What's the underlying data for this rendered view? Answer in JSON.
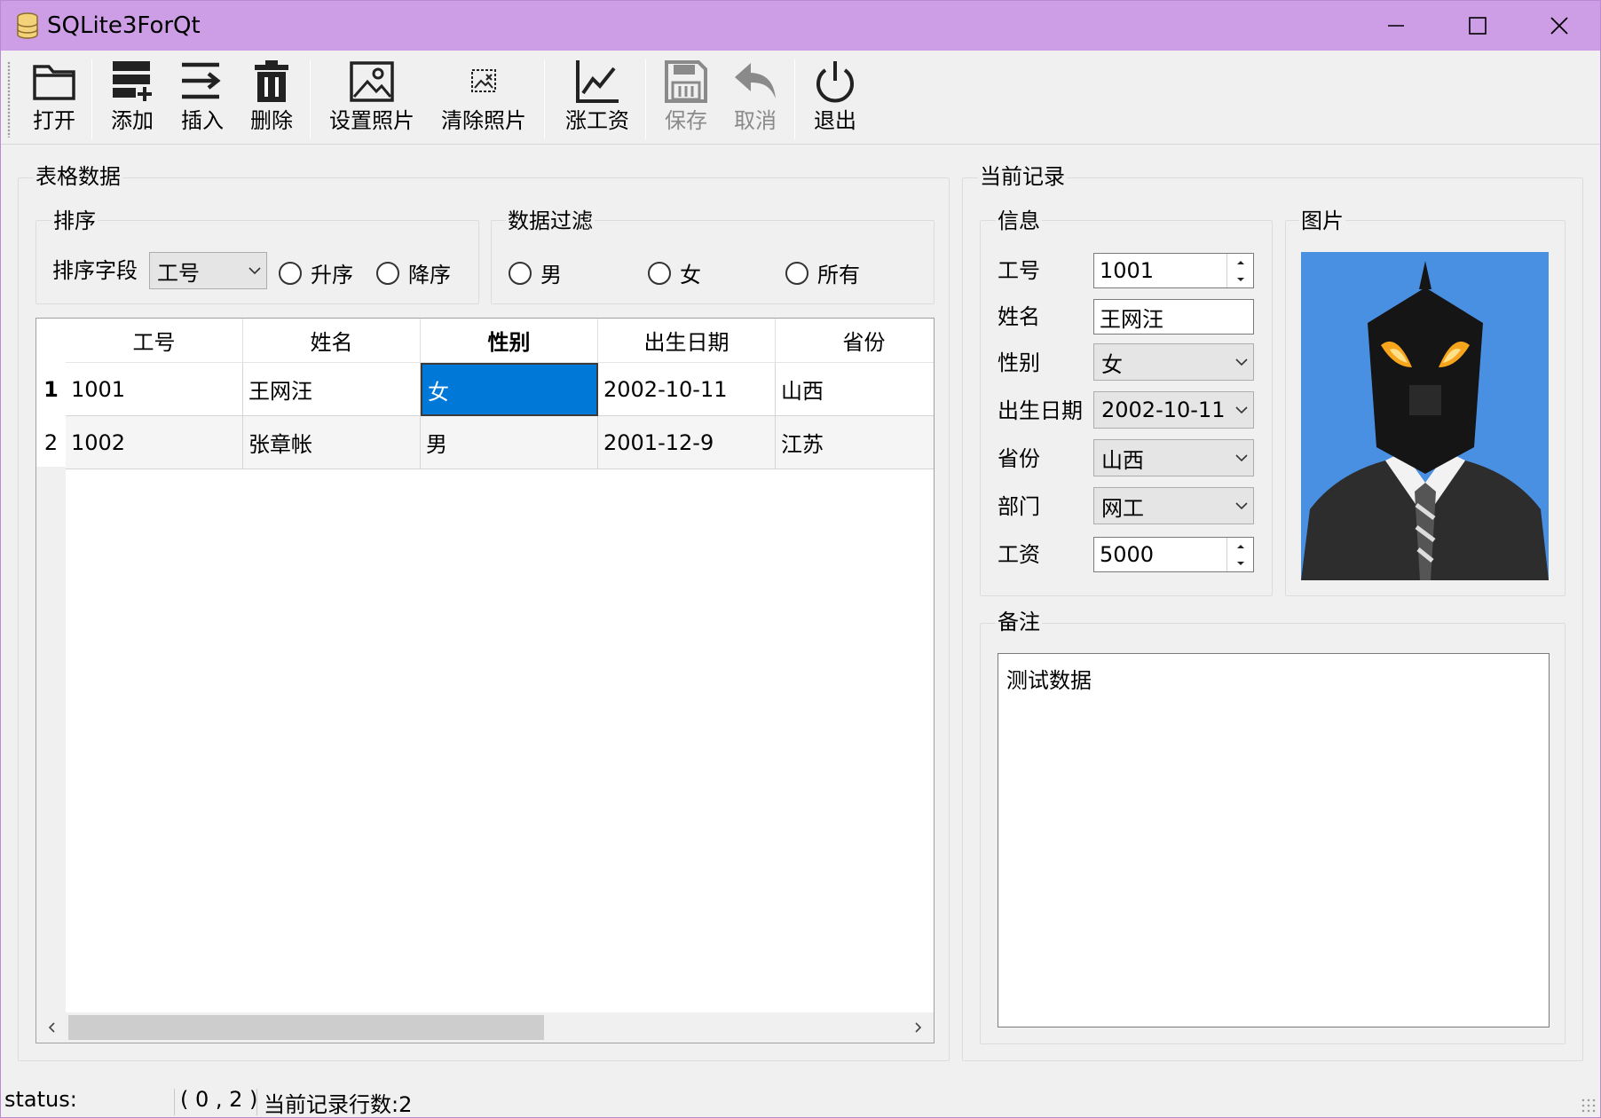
{
  "window": {
    "title": "SQLite3ForQt"
  },
  "toolbar": [
    {
      "label": "打开",
      "icon": "folder-icon",
      "enabled": true
    },
    {
      "label": "添加",
      "icon": "add-record-icon",
      "enabled": true
    },
    {
      "label": "插入",
      "icon": "insert-icon",
      "enabled": true
    },
    {
      "label": "删除",
      "icon": "trash-icon",
      "enabled": true
    },
    {
      "label": "设置照片",
      "icon": "image-icon",
      "enabled": true
    },
    {
      "label": "清除照片",
      "icon": "clear-image-icon",
      "enabled": true
    },
    {
      "label": "涨工资",
      "icon": "line-chart-icon",
      "enabled": true
    },
    {
      "label": "保存",
      "icon": "save-icon",
      "enabled": false
    },
    {
      "label": "取消",
      "icon": "undo-icon",
      "enabled": false
    },
    {
      "label": "退出",
      "icon": "power-icon",
      "enabled": true
    }
  ],
  "table_group": {
    "title": "表格数据",
    "sort": {
      "title": "排序",
      "field_label": "排序字段",
      "field_value": "工号",
      "asc": "升序",
      "desc": "降序"
    },
    "filter": {
      "title": "数据过滤",
      "male": "男",
      "female": "女",
      "all": "所有"
    },
    "columns": [
      "工号",
      "姓名",
      "性别",
      "出生日期",
      "省份"
    ],
    "row_headers": [
      "1",
      "2"
    ],
    "rows": [
      [
        "1001",
        "王网汪",
        "女",
        "2002-10-11",
        "山西"
      ],
      [
        "1002",
        "张章帐",
        "男",
        "2001-12-9",
        "江苏"
      ]
    ]
  },
  "record_group": {
    "title": "当前记录",
    "info": {
      "title": "信息",
      "labels": {
        "id": "工号",
        "name": "姓名",
        "gender": "性别",
        "birth": "出生日期",
        "province": "省份",
        "dept": "部门",
        "salary": "工资"
      },
      "values": {
        "id": "1001",
        "name": "王网汪",
        "gender": "女",
        "birth": "2002-10-11",
        "province": "山西",
        "dept": "网工",
        "salary": "5000"
      }
    },
    "photo": {
      "title": "图片"
    },
    "memo": {
      "title": "备注",
      "text": "测试数据"
    }
  },
  "status": {
    "label": "status:",
    "cell": "( 0 , 2 )",
    "count": "当前记录行数:2"
  },
  "colors": {
    "titlebar": "#cd9ee6",
    "selection": "#0078d7",
    "photo_bg": "#4a90e2"
  }
}
